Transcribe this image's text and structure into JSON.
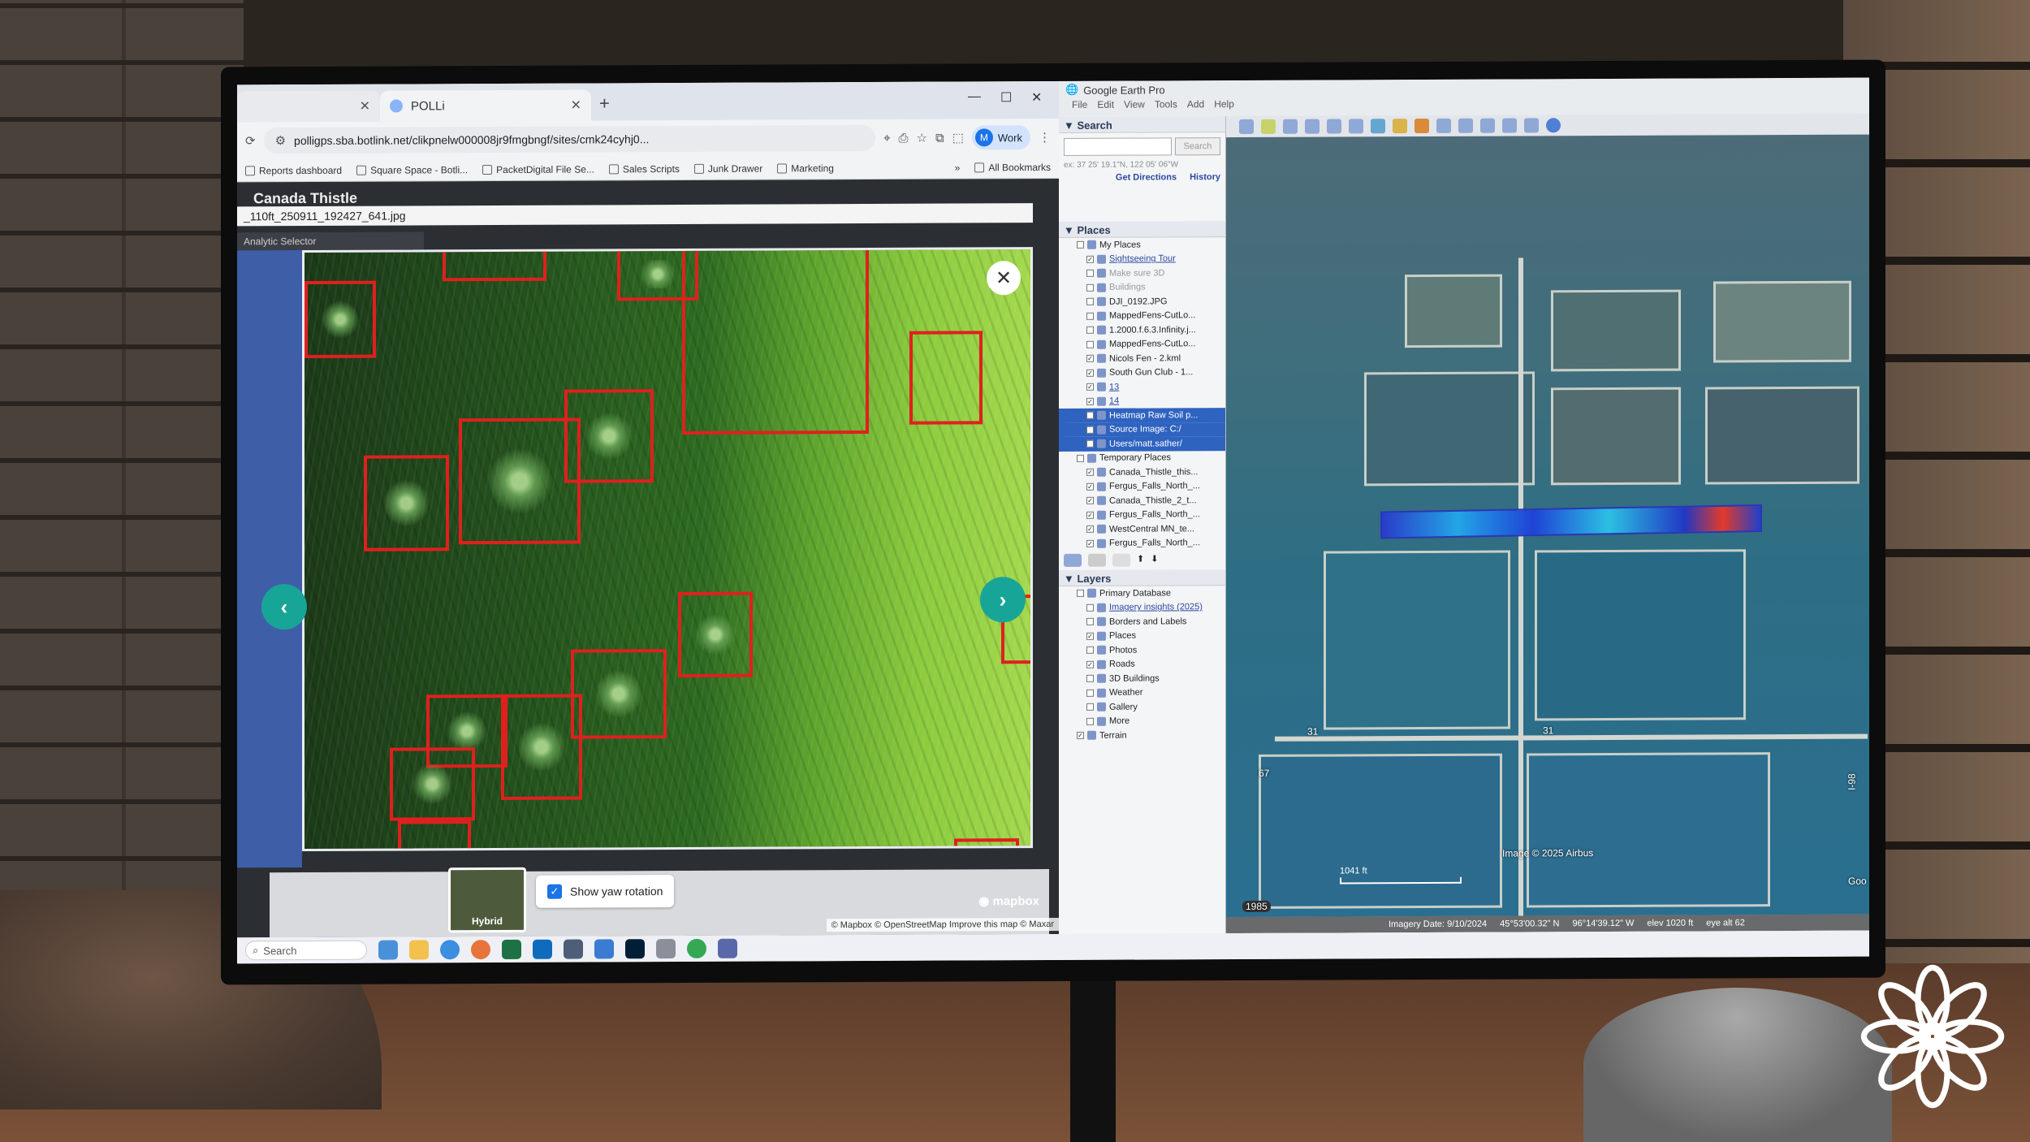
{
  "chrome": {
    "tabs": [
      {
        "label": ""
      },
      {
        "label": "POLLi"
      }
    ],
    "url": "polligps.sba.botlink.net/clikpnelw000008jr9fmgbngf/sites/cmk24cyhj0...",
    "profile": {
      "initial": "M",
      "label": "Work"
    },
    "bookmarks": [
      "Reports dashboard",
      "Square Space - Botli...",
      "PacketDigital File Se...",
      "Sales Scripts",
      "Junk Drawer",
      "Marketing"
    ],
    "bookmarks_more": "»",
    "all_bookmarks": "All Bookmarks"
  },
  "viewer": {
    "app_title": "Canada Thistle",
    "filename": "_110ft_250911_192427_641.jpg",
    "selector": "Analytic Selector",
    "layer_label": "Hybrid",
    "yaw_label": "Show yaw rotation",
    "yaw_checked": true,
    "mapbox": "mapbox",
    "attribution": "© Mapbox © OpenStreetMap  Improve this map  © Maxar"
  },
  "earth": {
    "title": "Google Earth Pro",
    "menu": [
      "File",
      "Edit",
      "View",
      "Tools",
      "Add",
      "Help"
    ],
    "search_section": "Search",
    "search_button": "Search",
    "search_hint": "ex: 37 25' 19.1\"N, 122 05' 06\"W",
    "get_directions": "Get Directions",
    "history": "History",
    "places_section": "Places",
    "places": [
      {
        "label": "My Places",
        "level": 1,
        "checked": false,
        "style": ""
      },
      {
        "label": "Sightseeing Tour",
        "level": 2,
        "checked": true,
        "style": "link"
      },
      {
        "label": "Make sure 3D",
        "level": 2,
        "checked": false,
        "style": "grey"
      },
      {
        "label": "Buildings",
        "level": 2,
        "checked": false,
        "style": "grey"
      },
      {
        "label": "DJI_0192.JPG",
        "level": 2,
        "checked": false,
        "style": ""
      },
      {
        "label": "MappedFens-CutLo...",
        "level": 2,
        "checked": false,
        "style": ""
      },
      {
        "label": "1.2000.f.6.3.Infinity.j...",
        "level": 2,
        "checked": false,
        "style": ""
      },
      {
        "label": "MappedFens-CutLo...",
        "level": 2,
        "checked": false,
        "style": ""
      },
      {
        "label": "Nicols Fen - 2.kml",
        "level": 2,
        "checked": true,
        "style": ""
      },
      {
        "label": "South Gun Club - 1...",
        "level": 2,
        "checked": true,
        "style": ""
      },
      {
        "label": "13",
        "level": 2,
        "checked": true,
        "style": "link"
      },
      {
        "label": "14",
        "level": 2,
        "checked": true,
        "style": "link"
      },
      {
        "label": "Heatmap Raw Soil p...",
        "level": 2,
        "checked": true,
        "style": "sel"
      },
      {
        "label": "Source Image: C:/",
        "level": 2,
        "checked": false,
        "style": "sel"
      },
      {
        "label": "Users/matt.sather/",
        "level": 2,
        "checked": false,
        "style": "sel"
      },
      {
        "label": "Temporary Places",
        "level": 1,
        "checked": false,
        "style": ""
      },
      {
        "label": "Canada_Thistle_this...",
        "level": 2,
        "checked": true,
        "style": ""
      },
      {
        "label": "Fergus_Falls_North_...",
        "level": 2,
        "checked": true,
        "style": ""
      },
      {
        "label": "Canada_Thistle_2_t...",
        "level": 2,
        "checked": true,
        "style": ""
      },
      {
        "label": "Fergus_Falls_North_...",
        "level": 2,
        "checked": true,
        "style": ""
      },
      {
        "label": "WestCentral MN_te...",
        "level": 2,
        "checked": true,
        "style": ""
      },
      {
        "label": "Fergus_Falls_North_...",
        "level": 2,
        "checked": true,
        "style": ""
      }
    ],
    "layers_section": "Layers",
    "layers": [
      {
        "label": "Primary Database",
        "level": 1,
        "checked": false,
        "style": ""
      },
      {
        "label": "Imagery insights (2025)",
        "level": 2,
        "checked": false,
        "style": "link"
      },
      {
        "label": "Borders and Labels",
        "level": 2,
        "checked": false,
        "style": ""
      },
      {
        "label": "Places",
        "level": 2,
        "checked": true,
        "style": ""
      },
      {
        "label": "Photos",
        "level": 2,
        "checked": false,
        "style": ""
      },
      {
        "label": "Roads",
        "level": 2,
        "checked": true,
        "style": ""
      },
      {
        "label": "3D Buildings",
        "level": 2,
        "checked": false,
        "style": ""
      },
      {
        "label": "Weather",
        "level": 2,
        "checked": false,
        "style": ""
      },
      {
        "label": "Gallery",
        "level": 2,
        "checked": false,
        "style": ""
      },
      {
        "label": "More",
        "level": 2,
        "checked": false,
        "style": ""
      },
      {
        "label": "Terrain",
        "level": 1,
        "checked": true,
        "style": ""
      }
    ],
    "map": {
      "road_labels": [
        "31",
        "31",
        "67"
      ],
      "image_credit": "Image © 2025 Airbus",
      "highway_label": "I-98",
      "google_label": "Goo",
      "scale": "1041 ft",
      "year": "1985"
    },
    "status": {
      "imagery_date": "Imagery Date: 9/10/2024",
      "lat": "45°53'00.32\" N",
      "lon": "96°14'39.12\" W",
      "elev": "elev  1020 ft",
      "eye_alt": "eye alt  62"
    }
  },
  "taskbar": {
    "search": "Search"
  }
}
